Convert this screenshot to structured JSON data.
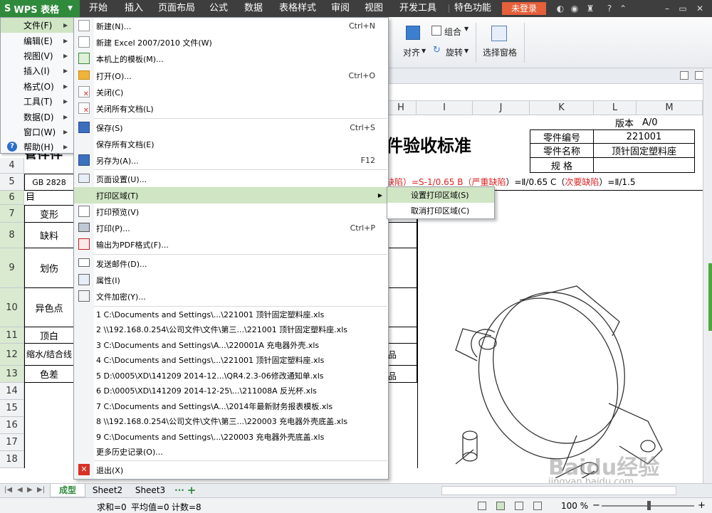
{
  "top_bar": {
    "app_button": "WPS 表格",
    "menus": [
      "开始",
      "插入",
      "页面布局",
      "公式",
      "数据",
      "表格样式",
      "审阅",
      "视图",
      "开发工具",
      "特色功能"
    ],
    "login": "未登录",
    "help": "?"
  },
  "ribbon": {
    "combine": "组合",
    "align": "对齐",
    "rotate": "旋转",
    "select_pane": "选择窗格"
  },
  "grid": {
    "columns": [
      "H",
      "I",
      "J",
      "K",
      "L",
      "M"
    ],
    "rows": [
      "4",
      "5",
      "6",
      "7",
      "8",
      "9",
      "10",
      "11",
      "12",
      "13",
      "14",
      "15",
      "16",
      "17",
      "18"
    ],
    "version_label": "版本",
    "version_value": "A/0",
    "title_fragment": "件验收标准",
    "part_no_label": "零件编号",
    "part_no_value": "221001",
    "part_name_label": "零件名称",
    "part_name_value": "顶针固定塑料座",
    "spec_label": "规 格",
    "left_partial_header": "管件件",
    "row5_text": "GB 2828",
    "row5_right_pre": "缺陷）=S-1/0.65 B（",
    "row5_serious": "严重缺陷",
    "row5_mid": "）=Ⅱ/0.65 C（",
    "row5_minor": "次要缺陷",
    "row5_post": "）=Ⅱ/1.5",
    "row6_text": "目",
    "items": [
      "变形",
      "缺料",
      "划伤",
      "异色点",
      "顶白",
      "缩水/结合线",
      "色差"
    ],
    "sample_12": "品",
    "sample_13": "品"
  },
  "sheets": {
    "tabs": [
      "成型",
      "Sheet2",
      "Sheet3"
    ],
    "more": "···",
    "add": "+"
  },
  "status": {
    "sum": "求和=0",
    "avg": "平均值=0",
    "count": "计数=8",
    "zoom": "100 %"
  },
  "menu1": {
    "items": [
      {
        "label": "文件(F)"
      },
      {
        "label": "编辑(E)"
      },
      {
        "label": "视图(V)"
      },
      {
        "label": "插入(I)"
      },
      {
        "label": "格式(O)"
      },
      {
        "label": "工具(T)"
      },
      {
        "label": "数据(D)"
      },
      {
        "label": "窗口(W)"
      },
      {
        "label": "帮助(H)"
      }
    ]
  },
  "menu2": {
    "items": [
      {
        "label": "新建(N)...",
        "shortcut": "Ctrl+N"
      },
      {
        "label": "新建 Excel 2007/2010 文件(W)",
        "shortcut": ""
      },
      {
        "label": "本机上的模板(M)...",
        "shortcut": ""
      },
      {
        "label": "打开(O)...",
        "shortcut": "Ctrl+O"
      },
      {
        "label": "关闭(C)",
        "shortcut": ""
      },
      {
        "label": "关闭所有文档(L)",
        "shortcut": ""
      },
      {
        "label": "保存(S)",
        "shortcut": "Ctrl+S"
      },
      {
        "label": "保存所有文档(E)",
        "shortcut": ""
      },
      {
        "label": "另存为(A)...",
        "shortcut": "F12"
      },
      {
        "label": "页面设置(U)...",
        "shortcut": ""
      },
      {
        "label": "打印区域(T)",
        "shortcut": ""
      },
      {
        "label": "打印预览(V)",
        "shortcut": ""
      },
      {
        "label": "打印(P)...",
        "shortcut": "Ctrl+P"
      },
      {
        "label": "输出为PDF格式(F)...",
        "shortcut": ""
      },
      {
        "label": "发送邮件(D)...",
        "shortcut": ""
      },
      {
        "label": "属性(I)",
        "shortcut": ""
      },
      {
        "label": "文件加密(Y)...",
        "shortcut": ""
      }
    ],
    "recent": [
      "1 C:\\Documents and Settings\\...\\221001 顶针固定塑料座.xls",
      "2 \\\\192.168.0.254\\公司文件\\文件\\第三...\\221001 顶针固定塑料座.xls",
      "3 C:\\Documents and Settings\\A...\\220001A 充电器外壳.xls",
      "4 C:\\Documents and Settings\\...\\221001 顶针固定塑料座.xls",
      "5 D:\\0005\\XD\\141209 2014-12...\\QR4.2.3-06修改通知单.xls",
      "6 D:\\0005\\XD\\141209 2014-12-25\\...\\211008A 反光杯.xls",
      "7 C:\\Documents and Settings\\A...\\2014年最新财务报表模板.xls",
      "8 \\\\192.168.0.254\\公司文件\\文件\\第三...\\220003 充电器外壳底盖.xls",
      "9 C:\\Documents and Settings\\...\\220003 充电器外壳底盖.xls"
    ],
    "more_history": "更多历史记录(O)...",
    "exit": "退出(X)"
  },
  "menu3": {
    "items": [
      {
        "label": "设置打印区域(S)"
      },
      {
        "label": "取消打印区域(C)"
      }
    ]
  },
  "watermark": {
    "main": "Baidu经验",
    "sub": "jingyan.baidu.com"
  },
  "colors": {
    "wps_green": "#2f8a3b",
    "highlight": "#cfe5c4",
    "login": "#e5603b",
    "red_text": "#e02020"
  }
}
